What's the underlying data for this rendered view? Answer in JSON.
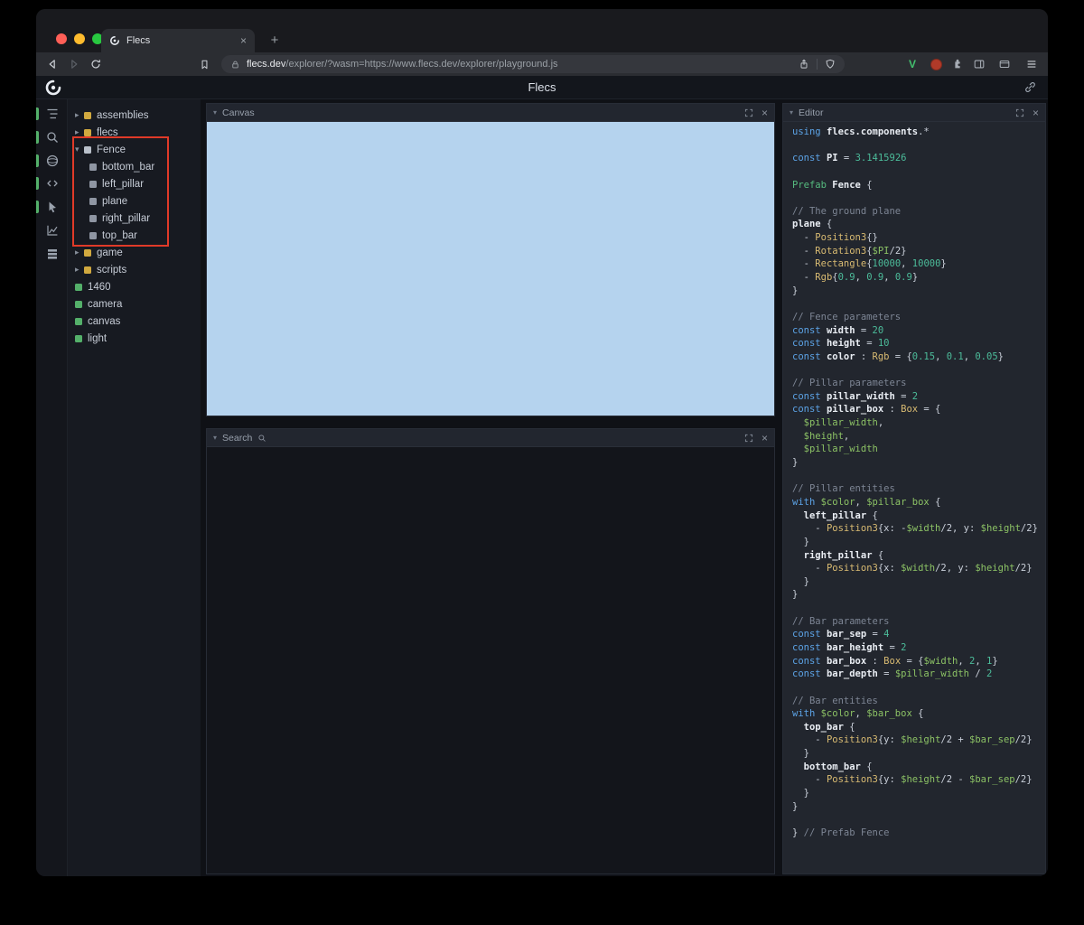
{
  "glyphs": {
    "close": "×",
    "plus": "+",
    "chevron_collapsed": "▸",
    "chevron_expanded": "▾",
    "panel_chevron": "▾"
  },
  "browser": {
    "tab": {
      "title": "Flecs"
    },
    "address": {
      "domain": "flecs.dev",
      "path": "/explorer/?wasm=https://www.flecs.dev/explorer/playground.js"
    },
    "extensions": {
      "vimium_label": "V"
    }
  },
  "page": {
    "header_title": "Flecs"
  },
  "sidebar": {
    "icons": [
      {
        "name": "tree-icon",
        "active": true
      },
      {
        "name": "search-icon",
        "active": true
      },
      {
        "name": "sphere-icon",
        "active": true
      },
      {
        "name": "code-icon",
        "active": true
      },
      {
        "name": "cursor-icon",
        "active": true
      },
      {
        "name": "chart-icon",
        "active": false
      },
      {
        "name": "stack-icon",
        "active": false
      }
    ]
  },
  "tree": {
    "items": [
      {
        "label": "assemblies",
        "state": "collapsed",
        "color": "yellow",
        "indent": 0
      },
      {
        "label": "flecs",
        "state": "collapsed",
        "color": "yellow",
        "indent": 0
      },
      {
        "label": "Fence",
        "state": "expanded",
        "color": "gray",
        "indent": 0
      },
      {
        "label": "bottom_bar",
        "state": "leaf",
        "color": "dim",
        "indent": 1
      },
      {
        "label": "left_pillar",
        "state": "leaf",
        "color": "dim",
        "indent": 1
      },
      {
        "label": "plane",
        "state": "leaf",
        "color": "dim",
        "indent": 1
      },
      {
        "label": "right_pillar",
        "state": "leaf",
        "color": "dim",
        "indent": 1
      },
      {
        "label": "top_bar",
        "state": "leaf",
        "color": "dim",
        "indent": 1
      },
      {
        "label": "game",
        "state": "collapsed",
        "color": "yellow",
        "indent": 0
      },
      {
        "label": "scripts",
        "state": "collapsed",
        "color": "yellow",
        "indent": 0
      },
      {
        "label": "1460",
        "state": "leaf",
        "color": "green",
        "indent": 0
      },
      {
        "label": "camera",
        "state": "leaf",
        "color": "green",
        "indent": 0
      },
      {
        "label": "canvas",
        "state": "leaf",
        "color": "green",
        "indent": 0
      },
      {
        "label": "light",
        "state": "leaf",
        "color": "green",
        "indent": 0
      }
    ]
  },
  "panels": {
    "canvas": {
      "title": "Canvas"
    },
    "search": {
      "title": "Search"
    },
    "editor": {
      "title": "Editor"
    }
  },
  "code": {
    "lines": [
      [
        [
          "k",
          "using "
        ],
        [
          "i",
          "flecs.components"
        ],
        [
          "p",
          ".*"
        ]
      ],
      [],
      [
        [
          "k",
          "const "
        ],
        [
          "i",
          "PI"
        ],
        [
          "p",
          " = "
        ],
        [
          "n",
          "3.1415926"
        ]
      ],
      [],
      [
        [
          "g",
          "Prefab "
        ],
        [
          "i",
          "Fence"
        ],
        [
          "p",
          " {"
        ]
      ],
      [],
      [
        [
          "c",
          "// The ground plane"
        ]
      ],
      [
        [
          "i",
          "plane"
        ],
        [
          "p",
          " {"
        ]
      ],
      [
        [
          "p",
          "  - "
        ],
        [
          "t",
          "Position3"
        ],
        [
          "p",
          "{}"
        ]
      ],
      [
        [
          "p",
          "  - "
        ],
        [
          "t",
          "Rotation3"
        ],
        [
          "p",
          "{"
        ],
        [
          "v",
          "$PI"
        ],
        [
          "p",
          "/2}"
        ]
      ],
      [
        [
          "p",
          "  - "
        ],
        [
          "t",
          "Rectangle"
        ],
        [
          "p",
          "{"
        ],
        [
          "n",
          "10000"
        ],
        [
          "p",
          ", "
        ],
        [
          "n",
          "10000"
        ],
        [
          "p",
          "}"
        ]
      ],
      [
        [
          "p",
          "  - "
        ],
        [
          "t",
          "Rgb"
        ],
        [
          "p",
          "{"
        ],
        [
          "n",
          "0.9"
        ],
        [
          "p",
          ", "
        ],
        [
          "n",
          "0.9"
        ],
        [
          "p",
          ", "
        ],
        [
          "n",
          "0.9"
        ],
        [
          "p",
          "}"
        ]
      ],
      [
        [
          "p",
          "}"
        ]
      ],
      [],
      [
        [
          "c",
          "// Fence parameters"
        ]
      ],
      [
        [
          "k",
          "const "
        ],
        [
          "i",
          "width"
        ],
        [
          "p",
          " = "
        ],
        [
          "n",
          "20"
        ]
      ],
      [
        [
          "k",
          "const "
        ],
        [
          "i",
          "height"
        ],
        [
          "p",
          " = "
        ],
        [
          "n",
          "10"
        ]
      ],
      [
        [
          "k",
          "const "
        ],
        [
          "i",
          "color"
        ],
        [
          "p",
          " : "
        ],
        [
          "t",
          "Rgb"
        ],
        [
          "p",
          " = {"
        ],
        [
          "n",
          "0.15"
        ],
        [
          "p",
          ", "
        ],
        [
          "n",
          "0.1"
        ],
        [
          "p",
          ", "
        ],
        [
          "n",
          "0.05"
        ],
        [
          "p",
          "}"
        ]
      ],
      [],
      [
        [
          "c",
          "// Pillar parameters"
        ]
      ],
      [
        [
          "k",
          "const "
        ],
        [
          "i",
          "pillar_width"
        ],
        [
          "p",
          " = "
        ],
        [
          "n",
          "2"
        ]
      ],
      [
        [
          "k",
          "const "
        ],
        [
          "i",
          "pillar_box"
        ],
        [
          "p",
          " : "
        ],
        [
          "t",
          "Box"
        ],
        [
          "p",
          " = {"
        ]
      ],
      [
        [
          "p",
          "  "
        ],
        [
          "v",
          "$pillar_width"
        ],
        [
          "p",
          ","
        ]
      ],
      [
        [
          "p",
          "  "
        ],
        [
          "v",
          "$height"
        ],
        [
          "p",
          ","
        ]
      ],
      [
        [
          "p",
          "  "
        ],
        [
          "v",
          "$pillar_width"
        ]
      ],
      [
        [
          "p",
          "}"
        ]
      ],
      [],
      [
        [
          "c",
          "// Pillar entities"
        ]
      ],
      [
        [
          "k",
          "with "
        ],
        [
          "v",
          "$color"
        ],
        [
          "p",
          ", "
        ],
        [
          "v",
          "$pillar_box"
        ],
        [
          "p",
          " {"
        ]
      ],
      [
        [
          "p",
          "  "
        ],
        [
          "i",
          "left_pillar"
        ],
        [
          "p",
          " {"
        ]
      ],
      [
        [
          "p",
          "    - "
        ],
        [
          "t",
          "Position3"
        ],
        [
          "p",
          "{x: -"
        ],
        [
          "v",
          "$width"
        ],
        [
          "p",
          "/2, y: "
        ],
        [
          "v",
          "$height"
        ],
        [
          "p",
          "/2}"
        ]
      ],
      [
        [
          "p",
          "  }"
        ]
      ],
      [
        [
          "p",
          "  "
        ],
        [
          "i",
          "right_pillar"
        ],
        [
          "p",
          " {"
        ]
      ],
      [
        [
          "p",
          "    - "
        ],
        [
          "t",
          "Position3"
        ],
        [
          "p",
          "{x: "
        ],
        [
          "v",
          "$width"
        ],
        [
          "p",
          "/2, y: "
        ],
        [
          "v",
          "$height"
        ],
        [
          "p",
          "/2}"
        ]
      ],
      [
        [
          "p",
          "  }"
        ]
      ],
      [
        [
          "p",
          "}"
        ]
      ],
      [],
      [
        [
          "c",
          "// Bar parameters"
        ]
      ],
      [
        [
          "k",
          "const "
        ],
        [
          "i",
          "bar_sep"
        ],
        [
          "p",
          " = "
        ],
        [
          "n",
          "4"
        ]
      ],
      [
        [
          "k",
          "const "
        ],
        [
          "i",
          "bar_height"
        ],
        [
          "p",
          " = "
        ],
        [
          "n",
          "2"
        ]
      ],
      [
        [
          "k",
          "const "
        ],
        [
          "i",
          "bar_box"
        ],
        [
          "p",
          " : "
        ],
        [
          "t",
          "Box"
        ],
        [
          "p",
          " = {"
        ],
        [
          "v",
          "$width"
        ],
        [
          "p",
          ", "
        ],
        [
          "n",
          "2"
        ],
        [
          "p",
          ", "
        ],
        [
          "n",
          "1"
        ],
        [
          "p",
          "}"
        ]
      ],
      [
        [
          "k",
          "const "
        ],
        [
          "i",
          "bar_depth"
        ],
        [
          "p",
          " = "
        ],
        [
          "v",
          "$pillar_width"
        ],
        [
          "p",
          " / "
        ],
        [
          "n",
          "2"
        ]
      ],
      [],
      [
        [
          "c",
          "// Bar entities"
        ]
      ],
      [
        [
          "k",
          "with "
        ],
        [
          "v",
          "$color"
        ],
        [
          "p",
          ", "
        ],
        [
          "v",
          "$bar_box"
        ],
        [
          "p",
          " {"
        ]
      ],
      [
        [
          "p",
          "  "
        ],
        [
          "i",
          "top_bar"
        ],
        [
          "p",
          " {"
        ]
      ],
      [
        [
          "p",
          "    - "
        ],
        [
          "t",
          "Position3"
        ],
        [
          "p",
          "{y: "
        ],
        [
          "v",
          "$height"
        ],
        [
          "p",
          "/2 + "
        ],
        [
          "v",
          "$bar_sep"
        ],
        [
          "p",
          "/2}"
        ]
      ],
      [
        [
          "p",
          "  }"
        ]
      ],
      [
        [
          "p",
          "  "
        ],
        [
          "i",
          "bottom_bar"
        ],
        [
          "p",
          " {"
        ]
      ],
      [
        [
          "p",
          "    - "
        ],
        [
          "t",
          "Position3"
        ],
        [
          "p",
          "{y: "
        ],
        [
          "v",
          "$height"
        ],
        [
          "p",
          "/2 - "
        ],
        [
          "v",
          "$bar_sep"
        ],
        [
          "p",
          "/2}"
        ]
      ],
      [
        [
          "p",
          "  }"
        ]
      ],
      [
        [
          "p",
          "}"
        ]
      ],
      [],
      [
        [
          "p",
          "} "
        ],
        [
          "c",
          "// Prefab Fence"
        ]
      ]
    ]
  },
  "colors": {
    "accent_green": "#54b06a",
    "module_yellow": "#d1a93f",
    "canvas_blue": "#b5d3ee",
    "annotation_red": "#e03a28"
  }
}
